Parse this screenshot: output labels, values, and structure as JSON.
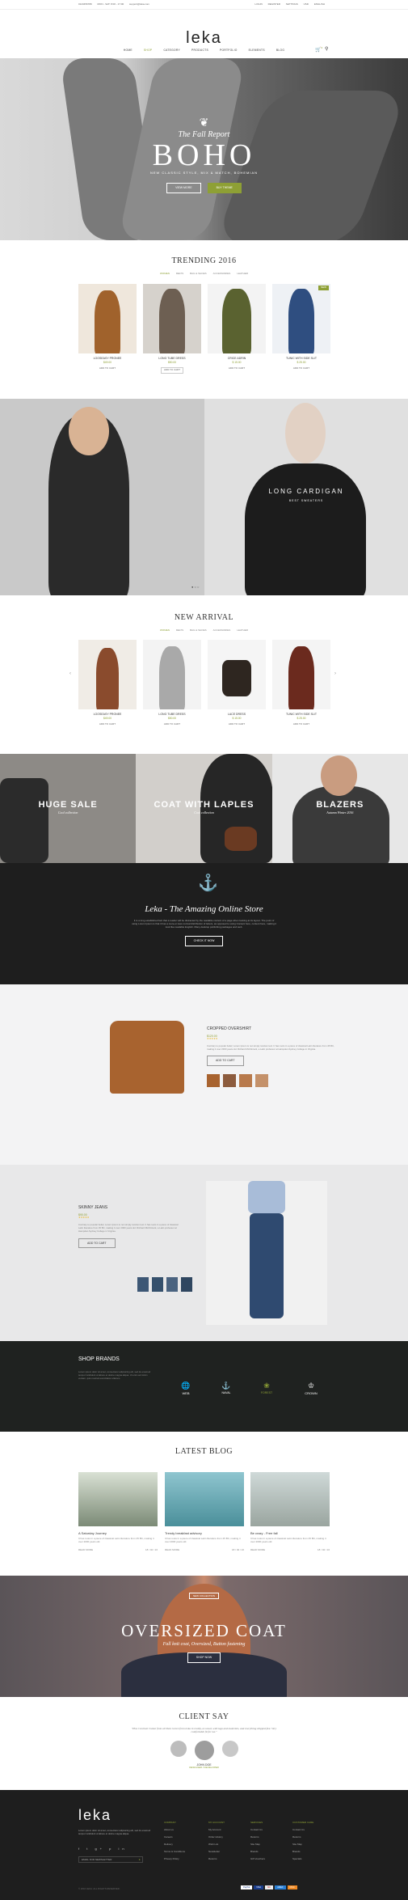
{
  "topbar": {
    "phone": "0123456789",
    "hours": "MON - SAT: 8:00 - 17:00",
    "email": "support@leka.com",
    "login": "LOGIN",
    "register": "REGISTER",
    "settings": "SETTINGS",
    "currency": "USD",
    "language": "ENGLISH"
  },
  "header": {
    "logo": "leka",
    "nav": [
      "HOME",
      "SHOP",
      "CATEGORY",
      "PRODUCTS",
      "PORTFOLIO",
      "ELEMENTS",
      "BLOG"
    ],
    "cart_count": "0"
  },
  "hero": {
    "subtitle": "The Fall Report",
    "title": "BOHO",
    "tagline": "NEW CLASSIC STYLE, MIX & MATCH, BOHEMIAN",
    "btn_shop": "VIEW MORE",
    "btn_buy": "BUY THEME"
  },
  "trending": {
    "title": "TRENDING 2016",
    "tabs": [
      "WOMEN",
      "MEN'S",
      "BAG & SHOES",
      "ACCESSORIES",
      "LEATHER"
    ],
    "products": [
      {
        "name": "LOOSEASY PRONEE",
        "price": "$49.00",
        "add": "ADD TO CART"
      },
      {
        "name": "LONG TUBE DRESS",
        "price": "$50.00",
        "add": "ADD TO CART",
        "badge": ""
      },
      {
        "name": "CRICE ADRIN",
        "price": "$ 15.00",
        "add": "ADD TO CART"
      },
      {
        "name": "TUNIC WITH SIDE SLIT",
        "price": "$ 25.00",
        "add": "ADD TO CART",
        "badge": "NEW"
      }
    ]
  },
  "banner": {
    "title": "LONG CARDIGAN",
    "subtitle": "BEST SWEATERS"
  },
  "arrival": {
    "title": "NEW ARRIVAL",
    "tabs": [
      "WOMEN",
      "MEN'S",
      "BAG & SHOES",
      "ACCESSORIES",
      "LEATHER"
    ],
    "products": [
      {
        "name": "LOOSEASY PRONEE",
        "price": "$49.00",
        "add": "ADD TO CART"
      },
      {
        "name": "LONG TUBE DRESS",
        "price": "$50.00",
        "add": "ADD TO CART"
      },
      {
        "name": "LACE DRESS",
        "price": "$ 15.00",
        "add": "ADD TO CART"
      },
      {
        "name": "TUNIC WITH SIDE SLIT",
        "price": "$ 25.00",
        "add": "ADD TO CART"
      }
    ]
  },
  "promos": [
    {
      "title": "HUGE SALE",
      "sub": "Cool collection"
    },
    {
      "title": "COAT WITH LAPLES",
      "sub": "Cool collection"
    },
    {
      "title": "BLAZERS",
      "sub": "Autumn Winter 2016"
    }
  ],
  "about": {
    "title": "Leka - The Amazing Online Store",
    "text": "It is a long established fact that a reader will be distracted by the readable content of a page when looking at its layout. The point of using Lorem Ipsum is that it has a more-or-less normal distribution of letters, as opposed to using Content here, content here, making it look like readable English. Many desktop publishing packages and web.",
    "btn": "CHECK IT NOW"
  },
  "feat1": {
    "name": "CROPPED OVERSHIRT",
    "price": "$120.00",
    "desc": "Contrary to popular belief, Lorem Ipsum is not simply random text. It has roots in a piece of classical Latin literature from 45 BC, making it over 2000 years old. Richard McClintock, a Latin professor at Hampden-Sydney College in Virginia.",
    "btn": "ADD TO CART"
  },
  "feat2": {
    "name": "SKINNY JEANS",
    "price": "$90.00",
    "desc": "Contrary to popular belief, Lorem Ipsum is not simply random text. It has roots in a piece of classical Latin literature from 45 BC, making it over 2000 years old. Richard McClintock, a Latin professor at Hampden-Sydney College in Virginia.",
    "btn": "ADD TO CART"
  },
  "brands": {
    "title": "SHOP BRANDS",
    "text": "Lorem ipsum dolor sit amet, consectetur adipisicing elit, sed do eiusmod tempor incididunt ut labore et dolore magna aliqua. Ut enim ad minim veniam, quis nostrud exercitation ullamco.",
    "logos": [
      "WEB",
      "NAVAL",
      "FOREST",
      "CROWN"
    ]
  },
  "blog": {
    "title": "LATEST BLOG",
    "posts": [
      {
        "title": "A Saturday Journey",
        "text": "It has roots in a piece of classical Latin literature from 45 BC, making it over 2000 years old.",
        "more": "READ MORE",
        "date": "18 / 02 / 16"
      },
      {
        "title": "Trendy breakfast advisory",
        "text": "It has roots in a piece of classical Latin literature from 45 BC, making it over 2000 years old.",
        "more": "READ MORE",
        "date": "18 / 02 / 16"
      },
      {
        "title": "Be crazy - Free fall",
        "text": "It has roots in a piece of classical Latin literature from 45 BC, making it over 2000 years old.",
        "more": "READ MORE",
        "date": "18 / 02 / 16"
      }
    ]
  },
  "oversize": {
    "badge": "NEW COLLECTION",
    "title": "OVERSIZED COAT",
    "sub": "Fall knit coat, Oversized, Button fastening",
    "btn": "SHOP NOW"
  },
  "client": {
    "title": "CLIENT SAY",
    "quote": "\"Plus Contrast Cutout from all Sizes Green from Leka in reality, as usual, with tags and materials, and everything shipped fast. Very comfortable fit for me.\"",
    "name": "JOHN DOE",
    "role": "DESIGNER / DEVELOPER"
  },
  "footer": {
    "logo": "leka",
    "about": "Lorem ipsum dolor sit amet, consectetur adipisicing elit, sed do eiusmod tempor incididunt ut labore et dolore magna aliqua.",
    "newsletter": "EMAIL FOR NEWSLETTER",
    "cols": [
      {
        "title": "COMPANY",
        "items": [
          "About us",
          "Careers",
          "Delivery",
          "Terms & Conditions",
          "Privacy Policy"
        ]
      },
      {
        "title": "MY ACCOUNT",
        "items": [
          "My Account",
          "Order History",
          "Wish List",
          "Newsletter",
          "Returns"
        ]
      },
      {
        "title": "SERVICES",
        "items": [
          "Contact Us",
          "Returns",
          "Site Map",
          "Brands",
          "Gift Vouchers"
        ]
      },
      {
        "title": "CUSTOMER CARE",
        "items": [
          "Contact Us",
          "Returns",
          "Site Map",
          "Brands",
          "Specials"
        ]
      }
    ],
    "copyright": "© 2016 LEKA. ALL RIGHTS RESERVED.",
    "payments": [
      "PayPal",
      "VISA",
      "MC",
      "AMEX",
      "DISC"
    ]
  }
}
